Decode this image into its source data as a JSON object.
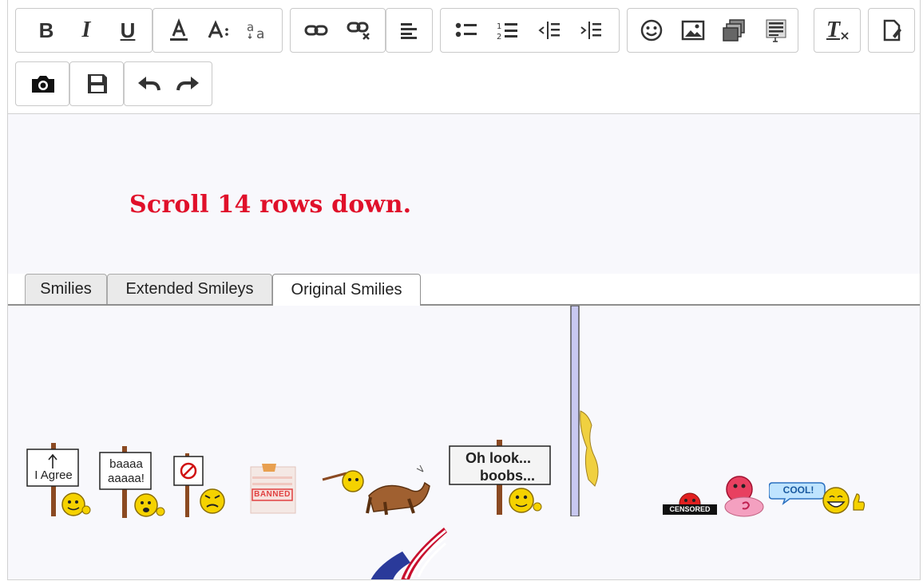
{
  "toolbar": {
    "buttons": {
      "bold": "B",
      "italic": "I",
      "underline": "U",
      "font_size": "A",
      "clear_format": "T"
    }
  },
  "editor": {
    "instruction": "Scroll 14 rows down."
  },
  "tabs": [
    {
      "label": "Smilies",
      "active": false
    },
    {
      "label": "Extended Smileys",
      "active": false
    },
    {
      "label": "Original Smilies",
      "active": true
    }
  ],
  "smilies": {
    "agree_sign": "I Agree",
    "baaaa_sign_line1": "baaaa",
    "baaaa_sign_line2": "aaaaa!",
    "banned_label": "BANNED",
    "boobs_sign_line1": "Oh look...",
    "boobs_sign_line2": "boobs...",
    "censored_label": "CENSORED",
    "cool_label": "COOL!"
  },
  "colors": {
    "instruction_text": "#e0102a",
    "smiley_yellow": "#f5d200",
    "flag_red": "#c8102e",
    "flag_blue": "#2a3a9a"
  }
}
